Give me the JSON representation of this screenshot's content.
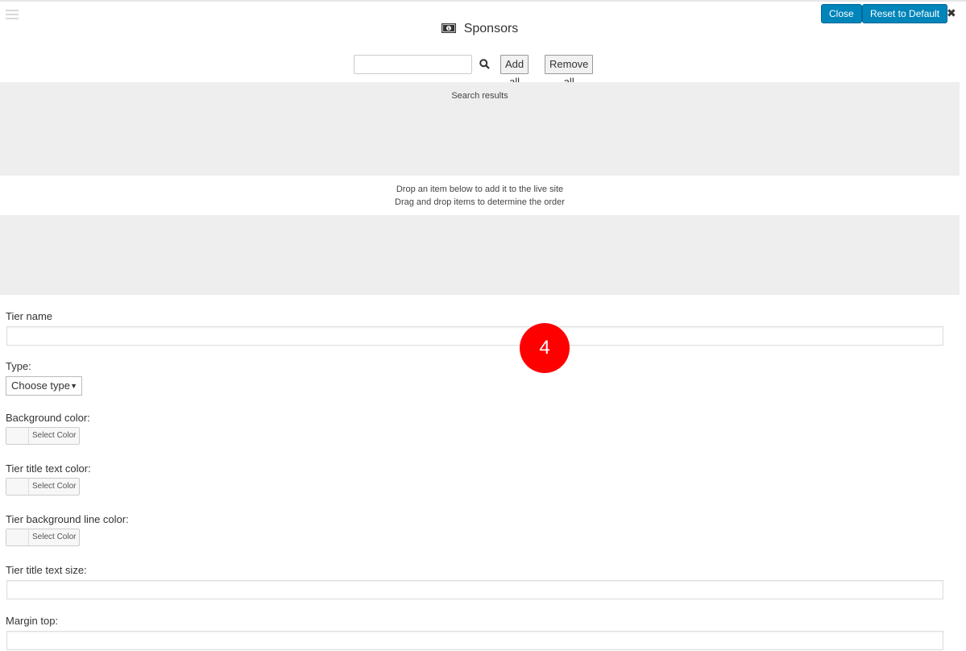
{
  "header": {
    "title": "Sponsors",
    "icon": "money-icon",
    "close_button": "Close",
    "reset_button": "Reset to Default",
    "close_x": "✖"
  },
  "search": {
    "value": "",
    "placeholder": "",
    "add_all": "Add all",
    "remove_all": "Remove all"
  },
  "results": {
    "label": "Search results"
  },
  "drop": {
    "line1": "Drop an item below to add it to the live site",
    "line2": "Drag and drop items to determine the order"
  },
  "form": {
    "tier_name_label": "Tier name",
    "tier_name_value": "",
    "type_label": "Type:",
    "type_selected": "Choose type",
    "background_color_label": "Background color:",
    "title_text_color_label": "Tier title text color:",
    "bg_line_color_label": "Tier background line color:",
    "select_color": "Select Color",
    "title_text_size_label": "Tier title text size:",
    "title_text_size_value": "",
    "margin_top_label": "Margin top:"
  },
  "annotation": {
    "number": "4",
    "color": "#ff0000"
  },
  "colors": {
    "accent": "#0085ba",
    "panel_gray": "#eeeeee"
  }
}
